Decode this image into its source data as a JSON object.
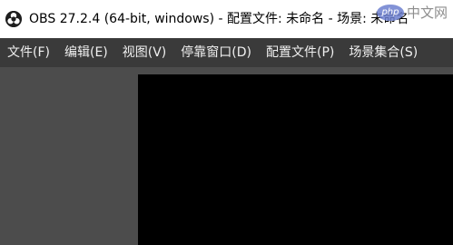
{
  "window": {
    "title": "OBS 27.2.4 (64-bit, windows) - 配置文件: 未命名 - 场景: 未命名",
    "icon": "obs-logo-icon"
  },
  "watermark": {
    "badge": "php",
    "text": "中文网"
  },
  "menubar": {
    "items": [
      {
        "label": "文件(F)"
      },
      {
        "label": "编辑(E)"
      },
      {
        "label": "视图(V)"
      },
      {
        "label": "停靠窗口(D)"
      },
      {
        "label": "配置文件(P)"
      },
      {
        "label": "场景集合(S)"
      }
    ]
  },
  "colors": {
    "titlebar": "#ffffff",
    "menubar": "#3a3a3a",
    "workspace": "#4c4c4c",
    "preview": "#000000"
  }
}
